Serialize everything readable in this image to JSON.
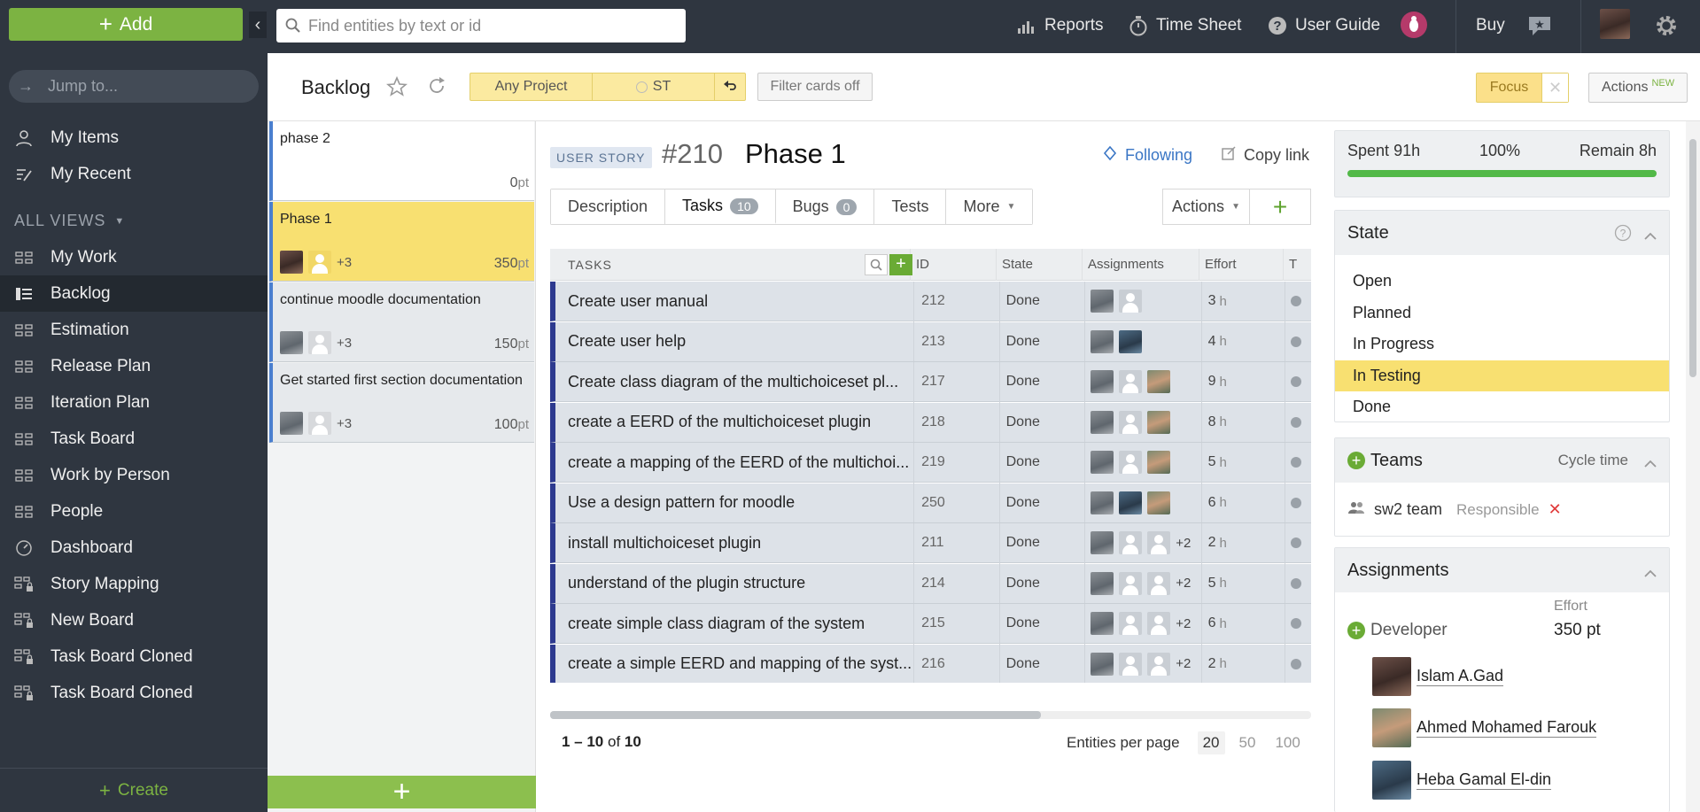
{
  "topbar": {
    "add_label": "Add",
    "search_placeholder": "Find entities by text or id",
    "reports": "Reports",
    "timesheet": "Time Sheet",
    "user_guide": "User Guide",
    "buy": "Buy"
  },
  "sidebar": {
    "jump_placeholder": "Jump to...",
    "my_items": "My Items",
    "my_recent": "My Recent",
    "all_views": "ALL VIEWS",
    "items": [
      {
        "label": "My Work",
        "icon": "board-icon"
      },
      {
        "label": "Backlog",
        "icon": "list-icon"
      },
      {
        "label": "Estimation",
        "icon": "board-icon"
      },
      {
        "label": "Release Plan",
        "icon": "board-icon"
      },
      {
        "label": "Iteration Plan",
        "icon": "board-icon"
      },
      {
        "label": "Task Board",
        "icon": "board-icon"
      },
      {
        "label": "Work by Person",
        "icon": "board-icon"
      },
      {
        "label": "People",
        "icon": "board-icon"
      },
      {
        "label": "Dashboard",
        "icon": "gauge-icon"
      },
      {
        "label": "Story Mapping",
        "icon": "locked-board-icon"
      },
      {
        "label": "New Board",
        "icon": "locked-board-icon"
      },
      {
        "label": "Task Board Cloned",
        "icon": "locked-board-icon"
      },
      {
        "label": "Task Board Cloned",
        "icon": "locked-board-icon"
      }
    ],
    "active_index": 1,
    "create_label": "Create"
  },
  "viewbar": {
    "title": "Backlog",
    "project_filter": "Any Project",
    "team_filter": "ST",
    "filter_cards": "Filter cards off",
    "focus": "Focus",
    "actions": "Actions",
    "actions_badge": "NEW"
  },
  "cards": [
    {
      "title": "phase 2",
      "points": "0",
      "unit": "pt",
      "assignees_more": ""
    },
    {
      "title": "Phase 1",
      "points": "350",
      "unit": "pt",
      "assignees_more": "+3"
    },
    {
      "title": "continue moodle documentation",
      "points": "150",
      "unit": "pt",
      "assignees_more": "+3"
    },
    {
      "title": "Get started first section documentation",
      "points": "100",
      "unit": "pt",
      "assignees_more": "+3"
    }
  ],
  "entity": {
    "type": "USER STORY",
    "id": "#210",
    "name": "Phase 1",
    "following": "Following",
    "copy_link": "Copy link",
    "tabs": [
      {
        "label": "Description",
        "badge": ""
      },
      {
        "label": "Tasks",
        "badge": "10"
      },
      {
        "label": "Bugs",
        "badge": "0"
      },
      {
        "label": "Tests",
        "badge": ""
      },
      {
        "label": "More",
        "badge": ""
      }
    ],
    "actions": "Actions"
  },
  "table": {
    "columns": [
      "TASKS",
      "ID",
      "State",
      "Assignments",
      "Effort",
      "T"
    ],
    "rows": [
      {
        "name": "Create user manual",
        "id": "212",
        "state": "Done",
        "more": "",
        "effort": "3",
        "unit": "h"
      },
      {
        "name": "Create user help",
        "id": "213",
        "state": "Done",
        "more": "",
        "effort": "4",
        "unit": "h"
      },
      {
        "name": "Create class diagram of the multichoiceset pl...",
        "id": "217",
        "state": "Done",
        "more": "",
        "effort": "9",
        "unit": "h"
      },
      {
        "name": "create a EERD of the multichoiceset plugin",
        "id": "218",
        "state": "Done",
        "more": "",
        "effort": "8",
        "unit": "h"
      },
      {
        "name": "create a mapping of the EERD of the multichoi...",
        "id": "219",
        "state": "Done",
        "more": "",
        "effort": "5",
        "unit": "h"
      },
      {
        "name": "Use a design pattern for moodle",
        "id": "250",
        "state": "Done",
        "more": "",
        "effort": "6",
        "unit": "h"
      },
      {
        "name": "install multichoiceset plugin",
        "id": "211",
        "state": "Done",
        "more": "+2",
        "effort": "2",
        "unit": "h"
      },
      {
        "name": "understand of the plugin structure",
        "id": "214",
        "state": "Done",
        "more": "+2",
        "effort": "5",
        "unit": "h"
      },
      {
        "name": "create simple class diagram of the system",
        "id": "215",
        "state": "Done",
        "more": "+2",
        "effort": "6",
        "unit": "h"
      },
      {
        "name": "create a simple EERD and mapping of the syst...",
        "id": "216",
        "state": "Done",
        "more": "+2",
        "effort": "2",
        "unit": "h"
      }
    ],
    "pager_range": "1 – 10",
    "pager_of": "of",
    "pager_total": "10",
    "per_page_label": "Entities per page",
    "per_page_options": [
      "20",
      "50",
      "100"
    ],
    "per_page_selected": "20"
  },
  "right": {
    "spent_label": "Spent",
    "spent_value": "91h",
    "progress_label": "100%",
    "progress_fraction": 1.0,
    "remain_label": "Remain",
    "remain_value": "8h",
    "state_title": "State",
    "states": [
      "Open",
      "Planned",
      "In Progress",
      "In Testing",
      "Done"
    ],
    "state_selected": "In Testing",
    "teams_title": "Teams",
    "cycle_time": "Cycle time",
    "team_name": "sw2 team",
    "team_role": "Responsible",
    "assignments_title": "Assignments",
    "effort_label": "Effort",
    "role": "Developer",
    "role_effort": "350 pt",
    "people": [
      "Islam A.Gad",
      "Ahmed Mohamed Farouk",
      "Heba Gamal El-din"
    ]
  },
  "colors": {
    "topbar": "#2f3640",
    "accent_green": "#7cb342",
    "selected_yellow": "#f8e071",
    "link_blue": "#3a76c5",
    "story_bar": "#2d3a8f"
  }
}
